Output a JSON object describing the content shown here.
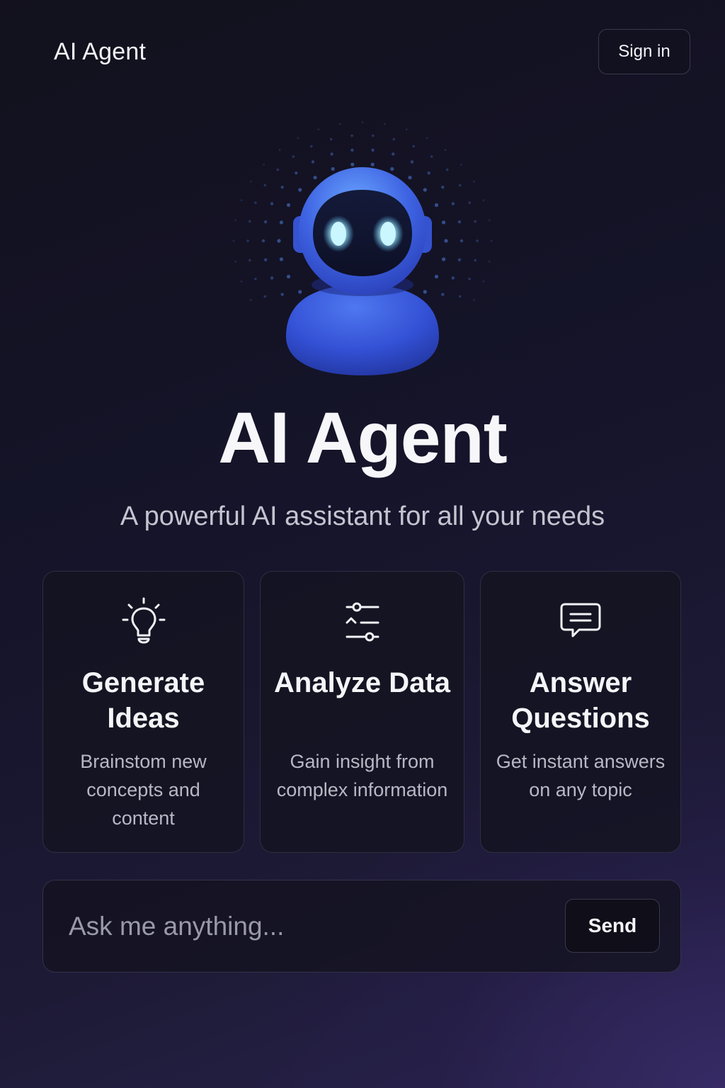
{
  "header": {
    "brand": "AI Agent",
    "signin_label": "Sign in"
  },
  "hero": {
    "title": "AI Agent",
    "tagline": "A powerful AI assistant for all your needs",
    "mascot_icon": "robot-icon"
  },
  "cards": [
    {
      "icon": "lightbulb-icon",
      "title": "Generate Ideas",
      "description": "Brainstom new concepts and content"
    },
    {
      "icon": "sliders-icon",
      "title": "Analyze Data",
      "description": "Gain insight from complex information"
    },
    {
      "icon": "chat-bubble-icon",
      "title": "Answer Questions",
      "description": "Get instant answers on any topic"
    }
  ],
  "chat": {
    "placeholder": "Ask me anything...",
    "send_label": "Send"
  },
  "colors": {
    "background_top": "#12111d",
    "background_bottom": "#29234c",
    "robot_blue": "#3b64e0",
    "robot_eye": "#9ee9ff",
    "card_border": "#2f2e42",
    "text_primary": "#f5f5f8",
    "text_secondary": "#b8b7c4"
  }
}
